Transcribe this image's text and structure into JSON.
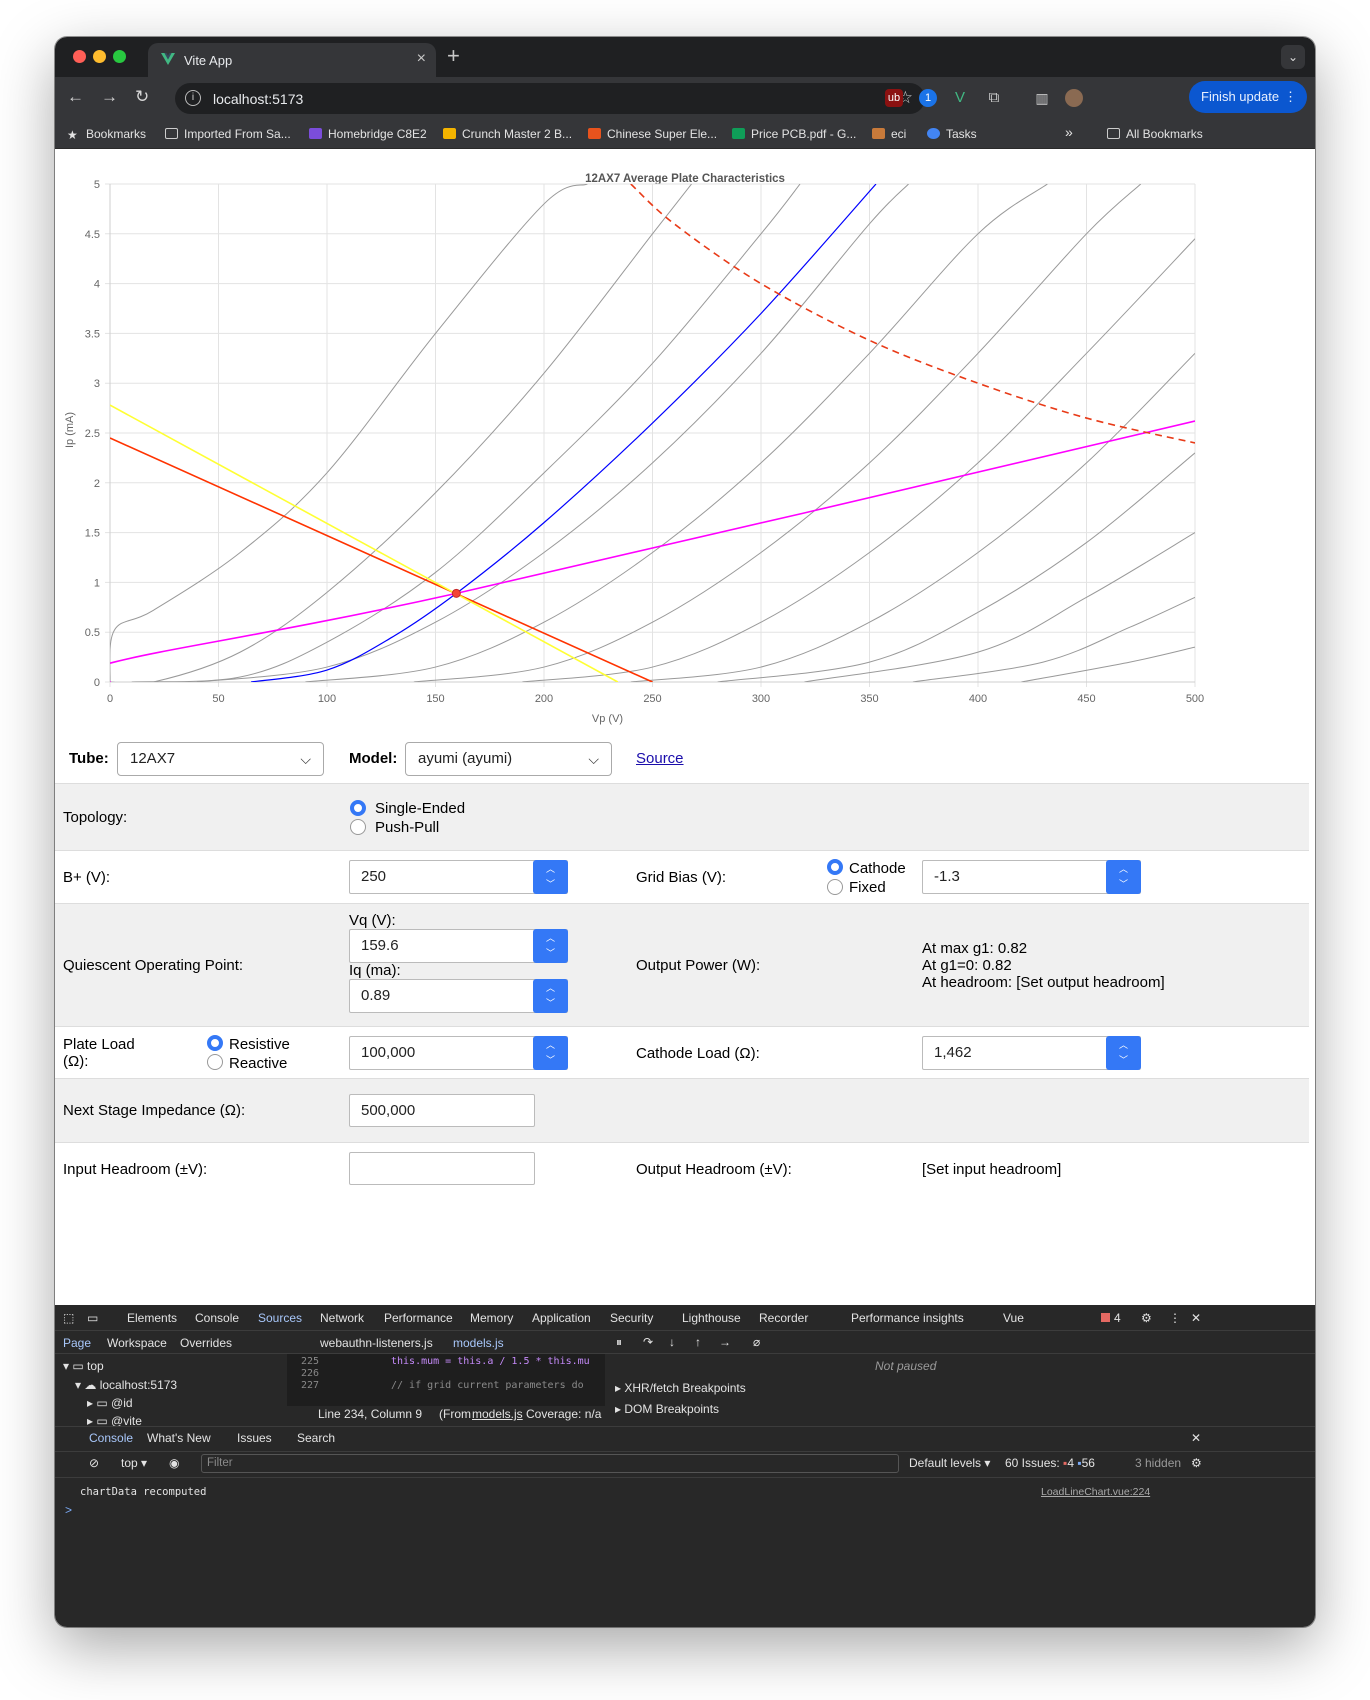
{
  "browser": {
    "tab_title": "Vite App",
    "new_tab": "+",
    "url": "localhost:5173",
    "finish_update": "Finish update",
    "bookmarks": [
      "Bookmarks",
      "Imported From Sa...",
      "Homebridge C8E2",
      "Crunch Master 2 B...",
      "Chinese Super Ele...",
      "Price PCB.pdf - G...",
      "eci",
      "Tasks"
    ],
    "all_bookmarks": "All Bookmarks",
    "bookmarks_overflow": "»"
  },
  "chart_data": {
    "type": "line",
    "title": "12AX7 Average Plate Characteristics",
    "xlabel": "Vp (V)",
    "ylabel": "Ip (mA)",
    "xlim": [
      0,
      500
    ],
    "ylim": [
      0,
      5
    ],
    "x_ticks": [
      0,
      50,
      100,
      150,
      200,
      250,
      300,
      350,
      400,
      450,
      500
    ],
    "y_ticks": [
      0,
      0.5,
      1,
      1.5,
      2,
      2.5,
      3,
      3.5,
      4,
      4.5,
      5
    ],
    "grid": true,
    "series": [
      {
        "color": "#999999",
        "values_x": [
          0,
          2,
          20,
          60,
          100,
          150,
          200,
          220
        ],
        "values_y": [
          0,
          0.52,
          0.72,
          1.3,
          2.1,
          3.5,
          4.8,
          5.0
        ]
      },
      {
        "color": "#999999",
        "values_x": [
          0,
          20,
          60,
          100,
          150,
          200,
          250,
          268
        ],
        "values_y": [
          0,
          0.0,
          0.3,
          0.9,
          1.9,
          3.1,
          4.5,
          5.0
        ]
      },
      {
        "color": "#999999",
        "values_x": [
          10,
          60,
          100,
          150,
          200,
          250,
          300,
          318
        ],
        "values_y": [
          0,
          0.05,
          0.4,
          1.1,
          2.1,
          3.2,
          4.5,
          5.0
        ]
      },
      {
        "color": "#999999",
        "values_x": [
          40,
          100,
          150,
          200,
          250,
          300,
          350,
          368
        ],
        "values_y": [
          0,
          0.15,
          0.6,
          1.3,
          2.2,
          3.3,
          4.6,
          5.0
        ]
      },
      {
        "color": "#999999",
        "values_x": [
          90,
          150,
          200,
          250,
          300,
          350,
          400,
          432
        ],
        "values_y": [
          0,
          0.15,
          0.6,
          1.3,
          2.2,
          3.3,
          4.5,
          5.0
        ]
      },
      {
        "color": "#999999",
        "values_x": [
          140,
          200,
          250,
          300,
          350,
          400,
          450,
          475
        ],
        "values_y": [
          0,
          0.15,
          0.6,
          1.3,
          2.2,
          3.3,
          4.5,
          5.0
        ]
      },
      {
        "color": "#999999",
        "values_x": [
          190,
          250,
          300,
          350,
          400,
          450,
          500
        ],
        "values_y": [
          0,
          0.15,
          0.6,
          1.3,
          2.2,
          3.3,
          4.45
        ]
      },
      {
        "color": "#999999",
        "values_x": [
          240,
          300,
          350,
          400,
          450,
          500
        ],
        "values_y": [
          0,
          0.15,
          0.6,
          1.3,
          2.2,
          3.3
        ]
      },
      {
        "color": "#999999",
        "values_x": [
          280,
          350,
          400,
          450,
          500
        ],
        "values_y": [
          0,
          0.2,
          0.7,
          1.4,
          2.3
        ]
      },
      {
        "color": "#999999",
        "values_x": [
          320,
          400,
          450,
          500
        ],
        "values_y": [
          0,
          0.3,
          0.85,
          1.5
        ]
      },
      {
        "color": "#999999",
        "values_x": [
          370,
          430,
          470,
          500
        ],
        "values_y": [
          0,
          0.2,
          0.55,
          0.85
        ]
      },
      {
        "color": "#999999",
        "values_x": [
          420,
          470,
          500
        ],
        "values_y": [
          0,
          0.2,
          0.35
        ]
      },
      {
        "color": "#0000ff",
        "values_x": [
          65,
          100,
          130,
          159.6,
          200,
          250,
          300,
          353
        ],
        "values_y": [
          0,
          0.12,
          0.45,
          0.89,
          1.6,
          2.6,
          3.7,
          5.0
        ]
      },
      {
        "color": "#ff3300",
        "values_x": [
          0,
          250
        ],
        "values_y": [
          2.45,
          0
        ]
      },
      {
        "color": "#ffff33",
        "values_x": [
          0,
          234
        ],
        "values_y": [
          2.78,
          0
        ]
      },
      {
        "color": "#ff00ff",
        "values_x": [
          0,
          2,
          159.6,
          500
        ],
        "values_y": [
          0,
          0.2,
          0.89,
          2.62
        ]
      },
      {
        "color": "#e83a17",
        "dashed": true,
        "values_x": [
          240,
          260,
          300,
          350,
          400,
          450,
          500
        ],
        "values_y": [
          5.0,
          4.6,
          4.0,
          3.43,
          3.0,
          2.65,
          2.4
        ]
      }
    ],
    "operating_point": {
      "x": 159.6,
      "y": 0.89,
      "color": "#f44336"
    }
  },
  "form": {
    "tube_label": "Tube:",
    "tube_value": "12AX7",
    "model_label": "Model:",
    "model_value": "ayumi (ayumi)",
    "source_link": "Source",
    "topology_label": "Topology:",
    "topology_options": [
      "Single-Ended",
      "Push-Pull"
    ],
    "bplus_label": "B+ (V):",
    "bplus_value": "250",
    "grid_bias_label": "Grid Bias (V):",
    "grid_bias_options": [
      "Cathode",
      "Fixed"
    ],
    "grid_bias_value": "-1.3",
    "quiescent_label": "Quiescent Operating Point:",
    "vq_label": "Vq (V):",
    "vq_value": "159.6",
    "iq_label": "Iq (ma):",
    "iq_value": "0.89",
    "output_power_label": "Output Power (W):",
    "output_power_lines": [
      "At max g1: 0.82",
      "At g1=0: 0.82",
      "At headroom: [Set output headroom]"
    ],
    "plate_load_label_1": "Plate Load",
    "plate_load_label_2": "(Ω):",
    "plate_load_options": [
      "Resistive",
      "Reactive"
    ],
    "plate_load_value": "100,000",
    "cathode_load_label": "Cathode Load (Ω):",
    "cathode_load_value": "1,462",
    "next_stage_label": "Next Stage Impedance (Ω):",
    "next_stage_value": "500,000",
    "input_headroom_label": "Input Headroom (±V):",
    "input_headroom_value": "",
    "output_headroom_label": "Output Headroom (±V):",
    "output_headroom_value": "[Set input headroom]"
  },
  "devtools": {
    "tabs": [
      "Elements",
      "Console",
      "Sources",
      "Network",
      "Performance",
      "Memory",
      "Application",
      "Security",
      "Lighthouse",
      "Recorder",
      "Performance insights",
      "Vue"
    ],
    "active_tab": "Sources",
    "error_count": "4",
    "subtabs": [
      "Page",
      "Workspace",
      "Overrides"
    ],
    "files": [
      "webauthn-listeners.js",
      "models.js"
    ],
    "tree": [
      "top",
      "localhost:5173",
      "@id",
      "@vite"
    ],
    "code_lines": [
      {
        "num": "225",
        "code": "this.mum = this.a / 1.5 * this.mu"
      },
      {
        "num": "226",
        "code": ""
      },
      {
        "num": "227",
        "code": "// if grid current parameters do"
      }
    ],
    "status": "Line 234, Column 9",
    "from_label": "(From",
    "from_file": "models.js",
    "coverage": "Coverage: n/a",
    "not_paused": "Not paused",
    "breakpoints": [
      "XHR/fetch Breakpoints",
      "DOM Breakpoints"
    ],
    "drawer_tabs": [
      "Console",
      "What's New",
      "Issues",
      "Search"
    ],
    "context": "top",
    "filter_placeholder": "Filter",
    "levels": "Default levels",
    "issues_label": "60 Issues:",
    "issues_errors": "4",
    "issues_info": "56",
    "hidden": "3 hidden",
    "log_message": "chartData recomputed",
    "log_source": "LoadLineChart.vue:224",
    "prompt": ">"
  }
}
